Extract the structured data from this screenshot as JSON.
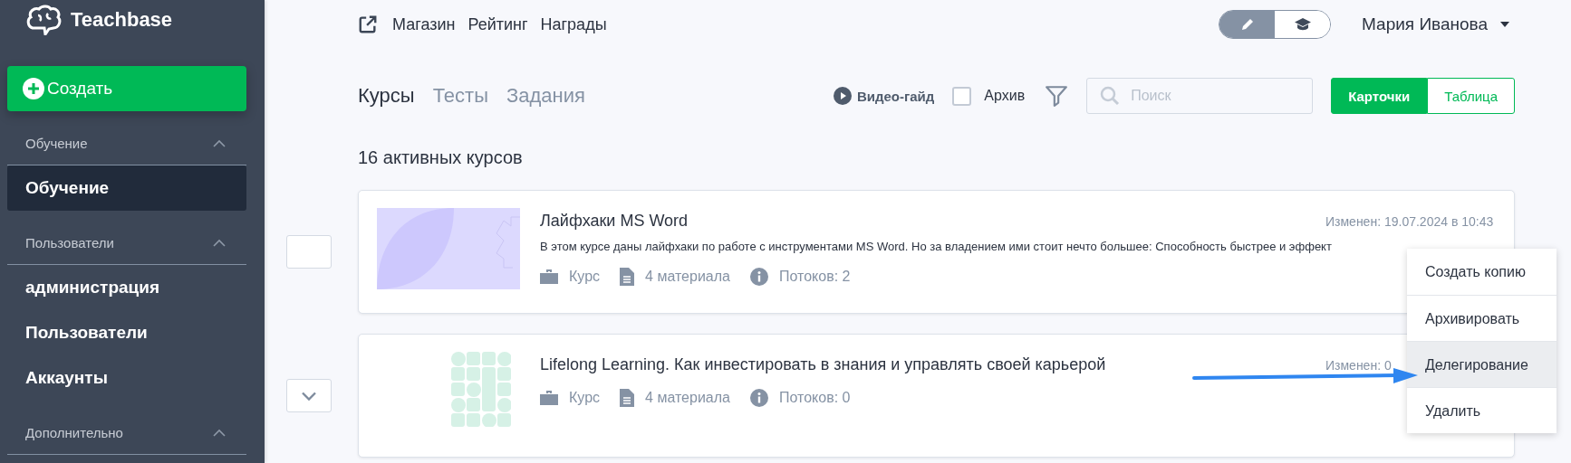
{
  "sidebar": {
    "logo": "Teachbase",
    "create_button": "Создать",
    "sections": [
      {
        "header": "Обучение",
        "expanded": true,
        "items": [
          {
            "label": "Обучение",
            "selected": true
          }
        ]
      },
      {
        "header": "Пользователи",
        "expanded": true,
        "items": [
          {
            "label": "администрация",
            "selected": false
          },
          {
            "label": "Пользователи",
            "selected": false
          },
          {
            "label": "Аккаунты",
            "selected": false
          }
        ]
      },
      {
        "header": "Дополнительно",
        "expanded": true
      }
    ]
  },
  "top_nav": {
    "links": [
      "Магазин",
      "Рейтинг",
      "Награды"
    ],
    "mode_toggle": [
      {
        "kind": "edit",
        "selected": true
      },
      {
        "kind": "learn",
        "selected": false
      }
    ],
    "user": "Мария Иванова"
  },
  "tabs": [
    {
      "label": "Курсы",
      "selected": true
    },
    {
      "label": "Тесты",
      "selected": false
    },
    {
      "label": "Задания",
      "selected": false
    }
  ],
  "toolbar": {
    "video_guide": "Видео-гайд",
    "archive": {
      "label": "Архив",
      "checked": false
    },
    "search": {
      "placeholder": "Поиск"
    },
    "view": [
      {
        "label": "Карточки",
        "selected": true
      },
      {
        "label": "Таблица",
        "selected": false
      }
    ]
  },
  "heading": "16 активных курсов",
  "courses": [
    {
      "control": {
        "kind": "checkbox",
        "checked": false
      },
      "thumbnail": {
        "kind": "leaf"
      },
      "title": "Лайфхаки MS Word",
      "modified": "Изменен: 19.07.2024 в 10:43",
      "description": "В этом курсе даны лайфхаки по работе с инструментами MS Word. Но за владением ими стоит нечто большее: Способность быстрее и эффект",
      "type": "Курс",
      "materials": "4 материала",
      "streams": "Потоков: 2"
    },
    {
      "control": {
        "kind": "expand"
      },
      "thumbnail": {
        "kind": "tiles"
      },
      "title": "Lifelong Learning. Как инвестировать в знания и управлять своей карьерой",
      "modified": "Изменен: 0",
      "type": "Курс",
      "materials": "4 материала",
      "streams": "Потоков: 0"
    }
  ],
  "context_menu": [
    {
      "label": "Создать копию",
      "selected": false
    },
    {
      "label": "Архивировать",
      "selected": false
    },
    {
      "label": "Делегирование",
      "selected": true
    },
    {
      "label": "Удалить",
      "selected": false
    }
  ]
}
